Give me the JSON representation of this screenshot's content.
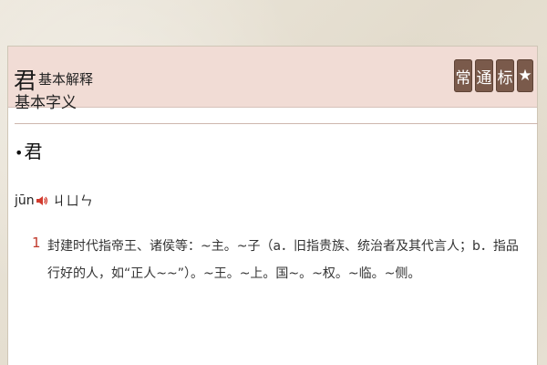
{
  "header": {
    "char": "君",
    "label": "基本解释",
    "badges": [
      "常",
      "通",
      "标",
      "★"
    ]
  },
  "section": {
    "title": "基本字义"
  },
  "entry": {
    "bullet": "•",
    "char": "君",
    "pinyin": "jūn",
    "zhuyin": "ㄐㄩㄣ"
  },
  "definitions": [
    {
      "number": "1",
      "text": "封建时代指帝王、诸侯等：~主。~子（a．旧指贵族、统治者及其代言人；b．指品行好的人，如“正人~~”）。~王。~上。国~。~权。~临。~侧。"
    }
  ],
  "colors": {
    "header_bg": "#f1dcd5",
    "badge_bg": "#7a5a4b",
    "number": "#c0392b"
  },
  "icons": {
    "speaker": "speaker-icon"
  }
}
